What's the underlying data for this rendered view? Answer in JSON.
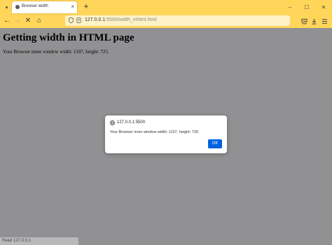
{
  "browser": {
    "tab": {
      "title": "Browser width",
      "close_glyph": "×"
    },
    "new_tab_glyph": "+",
    "window_controls": {
      "minimize": "–",
      "maximize": "☐",
      "close": "✕"
    },
    "nav": {
      "back": "←",
      "forward": "→",
      "stop": "✕",
      "home": "⌂"
    },
    "url": {
      "host": "127.0.0.1",
      "rest": ":5500/width_inhtml.html"
    },
    "toolbar_icons": [
      "pocket-icon",
      "download-icon",
      "menu-icon"
    ],
    "accent_color": "#ffd65a",
    "dimmed_content_color": "#919193"
  },
  "page": {
    "heading": "Getting width in HTML page",
    "text": "Your Browser inner window width: 1107, height: 725."
  },
  "dialog": {
    "origin": "127.0.0.1:5500",
    "message": "Your Browser inner window width: 1107, height: 725.",
    "ok_label": "OK",
    "button_color": "#0061e0"
  },
  "status": {
    "text": "Read 127.0.0.1"
  }
}
